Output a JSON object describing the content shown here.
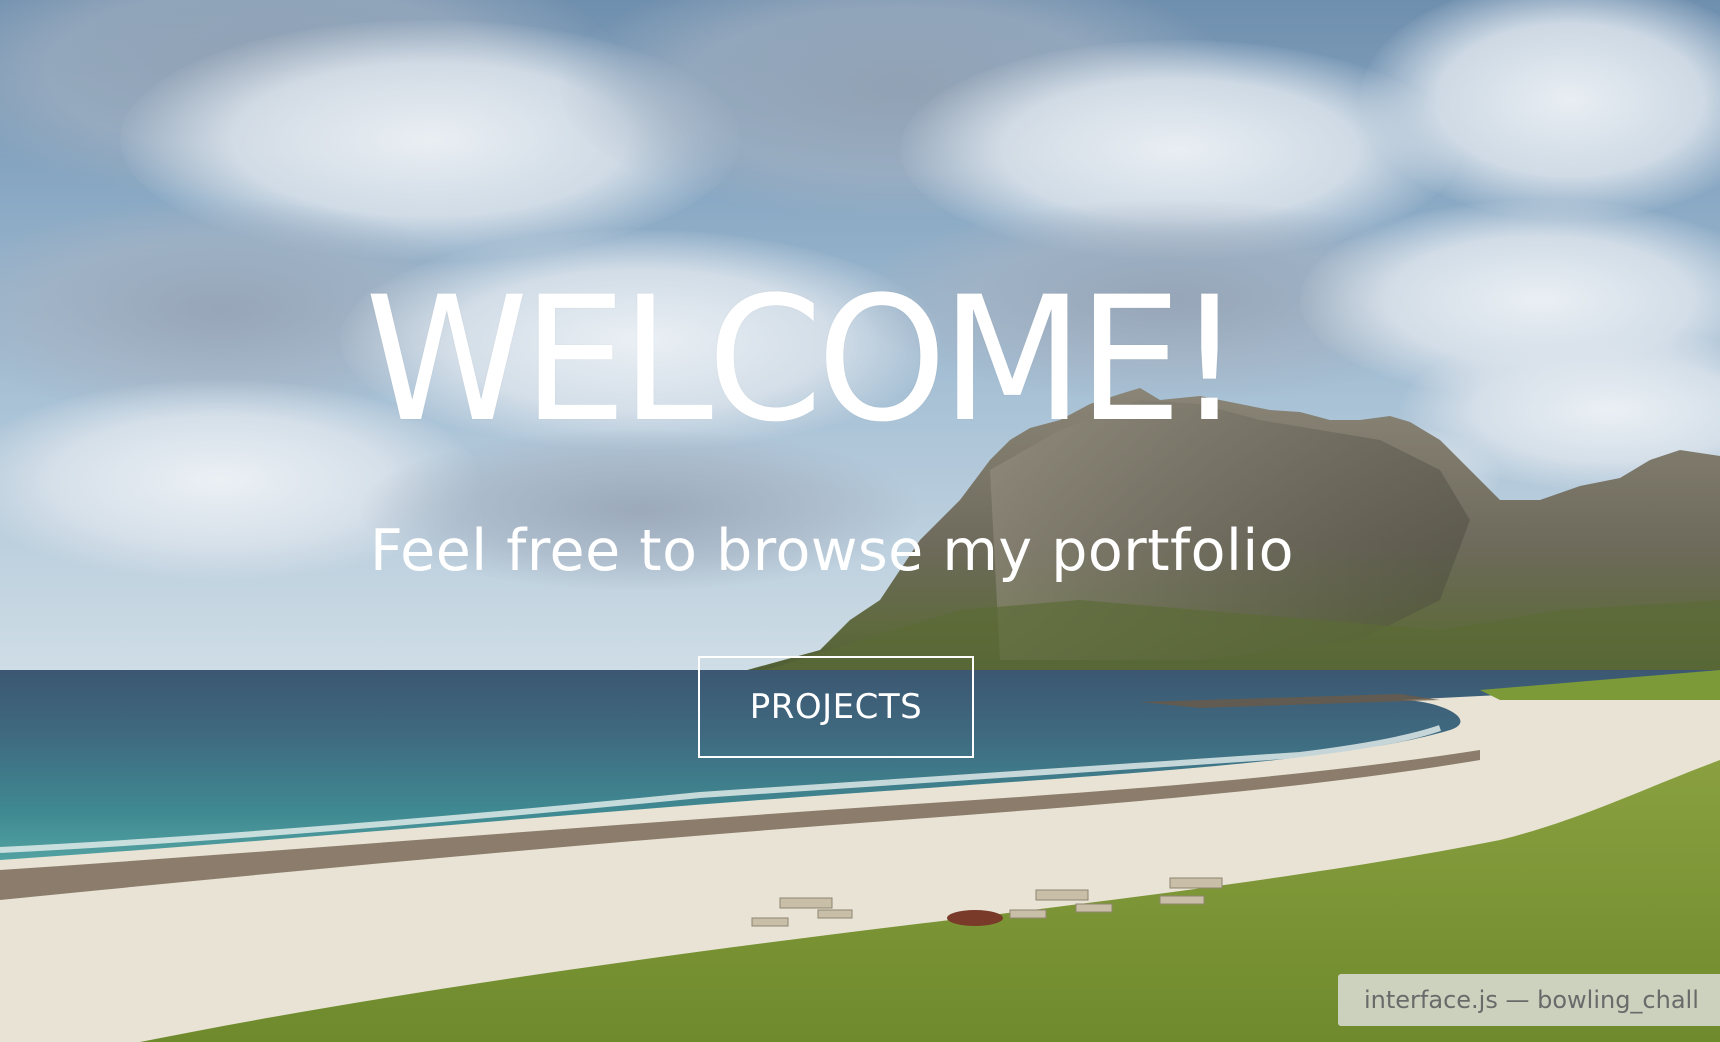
{
  "hero": {
    "title": "WELCOME!",
    "subtitle": "Feel free to browse my portfolio",
    "projects_button": "PROJECTS"
  },
  "tooltip": {
    "text": "interface.js — bowling_chall"
  },
  "colors": {
    "text": "#ffffff",
    "sky": "#8aa9c4",
    "sea": "#3f8a92",
    "grass": "#7e9a3a",
    "sand": "#e9e4d8"
  }
}
